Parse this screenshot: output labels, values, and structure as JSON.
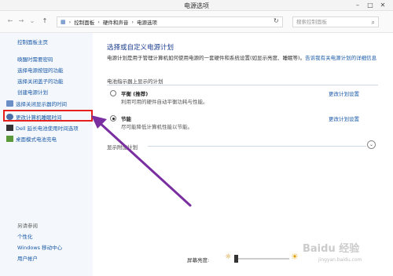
{
  "window": {
    "title": "电源选项"
  },
  "address": {
    "crumbs": [
      "控制面板",
      "硬件和声音",
      "电源选项"
    ],
    "search_placeholder": "搜索控制面板"
  },
  "sidebar": {
    "home": "控制面板主页",
    "items": [
      "唤醒时需要密码",
      "选择电源按钮的功能",
      "选择关闭盖子的功能",
      "创建电源计划",
      "选择关闭显示器的时间",
      "更改计算机睡眠时间",
      "Dell 延长电池使用时间选项",
      "桌面模式电池充电"
    ],
    "see_also": "另请参阅",
    "links": [
      "个性化",
      "Windows 移动中心",
      "用户帐户"
    ]
  },
  "main": {
    "heading": "选择或自定义电源计划",
    "description": "电源计划是用于管理计算机如何使用电源的一套硬件和系统设置(如显示亮度、睡眠等)。",
    "description_link": "告诉我有关电源计划的详细信息",
    "section": "电池指示器上显示的计划",
    "plans": [
      {
        "name": "平衡 (推荐)",
        "desc": "利用可用的硬件自动平衡功耗与性能。",
        "link": "更改计划设置",
        "selected": false
      },
      {
        "name": "节能",
        "desc": "尽可能降低计算机性能以节能。",
        "link": "更改计划设置",
        "selected": true
      }
    ],
    "more_plans": "显示附加计划"
  },
  "bottom": {
    "brightness_label": "屏幕亮度:",
    "brightness_level": 0.0
  },
  "watermark": {
    "text": "Baidu 经验",
    "sub": "jingyan.baidu.com"
  },
  "colors": {
    "highlight": "#e5201e",
    "arrow": "#7a2fa0",
    "link": "#1a5aa8"
  }
}
